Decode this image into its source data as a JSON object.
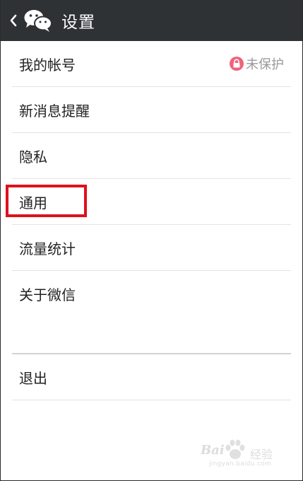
{
  "action_bar": {
    "title": "设置"
  },
  "settings": {
    "items": [
      {
        "label": "我的帐号",
        "status": "未保护"
      },
      {
        "label": "新消息提醒"
      },
      {
        "label": "隐私"
      },
      {
        "label": "通用"
      },
      {
        "label": "流量统计"
      },
      {
        "label": "关于微信"
      }
    ],
    "logout_label": "退出"
  },
  "watermark": {
    "brand": "Bai",
    "brand_cn": "经验",
    "url": "jingyan.baidu.com"
  },
  "colors": {
    "action_bar_bg": "#2f3235",
    "highlight": "#e0101c",
    "lock_icon": "#f0637a"
  },
  "icons": {
    "back": "chevron-left-icon",
    "logo": "wechat-logo-icon",
    "account_lock": "lock-icon",
    "watermark_logo": "paw-icon"
  }
}
